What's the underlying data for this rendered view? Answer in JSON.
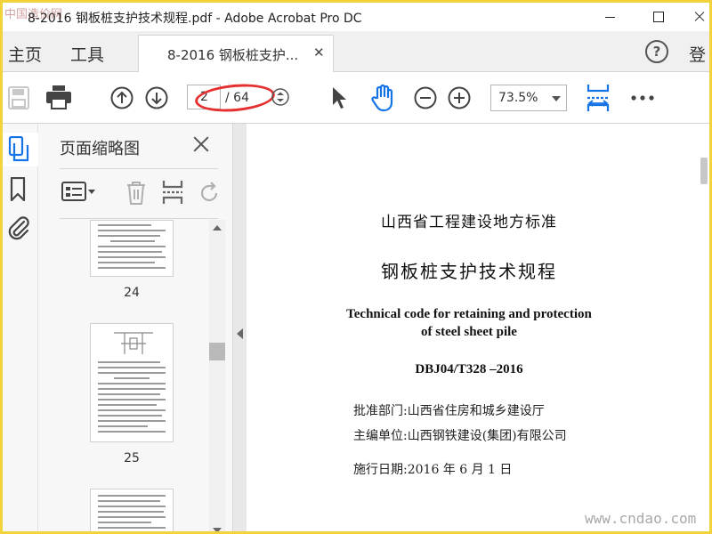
{
  "window": {
    "watermark_logo": "中国造价网",
    "title": "8-2016 钢板桩支护技术规程.pdf - Adobe Acrobat Pro DC"
  },
  "tabs": {
    "home": "主页",
    "tools": "工具",
    "document": "8-2016 钢板桩支护...",
    "signin": "登"
  },
  "toolbar": {
    "page_current": "2",
    "page_total": "/ 64",
    "zoom": "73.5%",
    "icons": [
      "save-icon",
      "print-icon",
      "prev-page-icon",
      "next-page-icon",
      "page-stepper-icon",
      "select-arrow-icon",
      "hand-tool-icon",
      "zoom-out-icon",
      "zoom-in-icon",
      "fit-width-icon",
      "more-icon"
    ]
  },
  "sidebar": {
    "panel_title": "页面缩略图",
    "thumbnails": [
      {
        "label": "24"
      },
      {
        "label": "25"
      }
    ]
  },
  "document": {
    "title_line1": "山西省工程建设地方标准",
    "title_line2": "钢板桩支护技术规程",
    "english_line1": "Technical code for retaining and protection",
    "english_line2": "of steel sheet pile",
    "code": "DBJ04/T328 –2016",
    "approver": "批准部门:山西省住房和城乡建设厅",
    "editor": "主编单位:山西钢铁建设(集团)有限公司",
    "effective_date": "施行日期:2016 年 6 月 1 日"
  },
  "watermark": "www.cndao.com",
  "colors": {
    "frame_border": "#f2d33a",
    "annotation_ellipse": "#e53030",
    "accent_blue": "#1473e6"
  }
}
